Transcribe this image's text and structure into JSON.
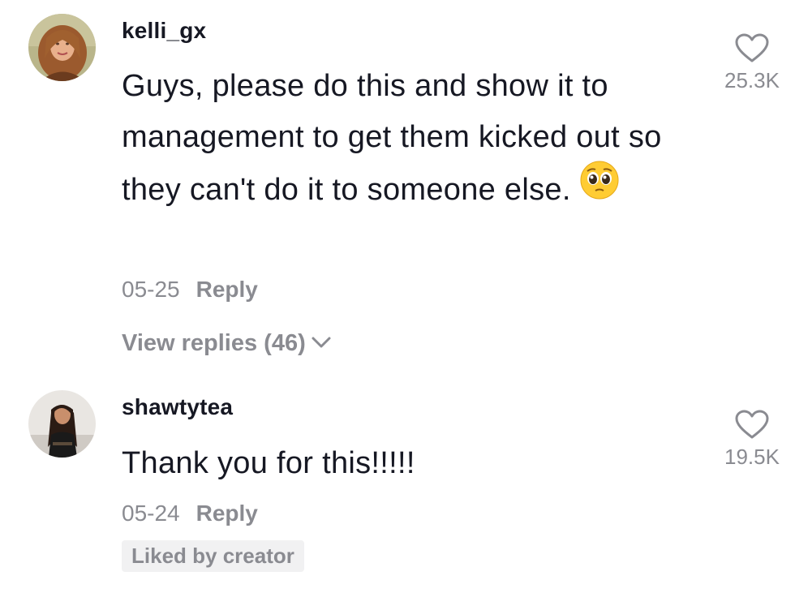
{
  "comments": [
    {
      "username": "kelli_gx",
      "text": "Guys, please do this and show it to management to get them kicked out so they can't do it to someone else.",
      "emoji": "pleading-face",
      "date": "05-25",
      "reply_label": "Reply",
      "likes": "25.3K",
      "view_replies": "View replies (46)",
      "avatar_icon": "avatar-photo"
    },
    {
      "username": "shawtytea",
      "text": "Thank you for this!!!!!",
      "date": "05-24",
      "reply_label": "Reply",
      "likes": "19.5K",
      "badge": "Liked by creator",
      "avatar_icon": "avatar-photo"
    }
  ],
  "colors": {
    "text_primary": "#161823",
    "text_secondary": "#8a8b91",
    "badge_bg": "#f1f1f2"
  }
}
